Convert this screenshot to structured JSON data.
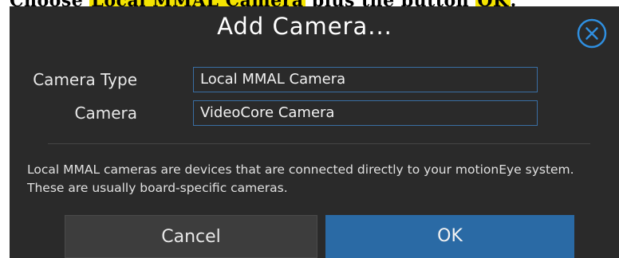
{
  "top_strip": {
    "prefix": "Choose",
    "highlight_1": "Local MMAL Camera",
    "middle": "plus the button",
    "highlight_2": "OK",
    "suffix": "."
  },
  "dialog": {
    "title": "Add Camera...",
    "close_icon": "close-circle-icon",
    "fields": [
      {
        "label": "Camera Type",
        "value": "Local MMAL Camera"
      },
      {
        "label": "Camera",
        "value": "VideoCore Camera"
      }
    ],
    "description": "Local MMAL cameras are devices that are connected directly to your motionEye system. These are usually board-specific cameras.",
    "buttons": {
      "cancel": "Cancel",
      "ok": "OK"
    }
  },
  "colors": {
    "dialog_bg": "#2a2a2a",
    "accent": "#2a6aa5",
    "field_border": "#3a6fa4",
    "cancel_bg": "#3d3d3d",
    "highlight": "#f4e400"
  }
}
